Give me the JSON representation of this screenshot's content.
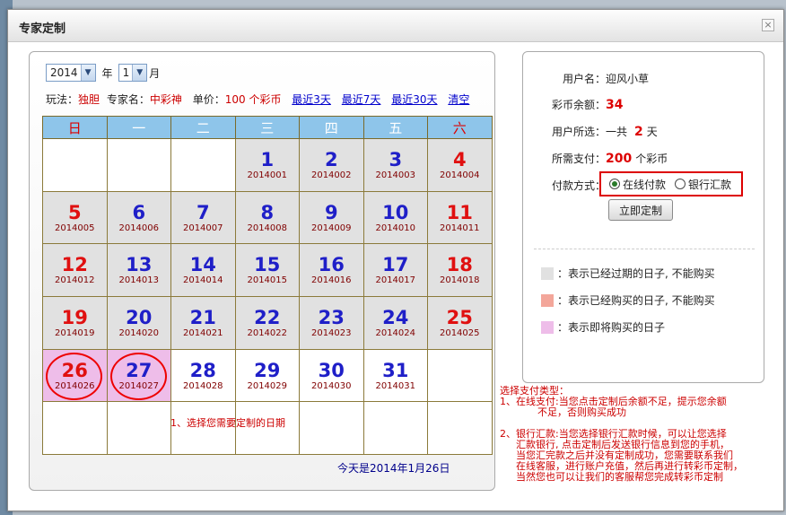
{
  "dialog": {
    "title": "专家定制",
    "close": "×"
  },
  "selectors": {
    "year": "2014",
    "year_label": "年",
    "month": "1",
    "month_label": "月"
  },
  "info": {
    "play_label": "玩法：",
    "play": "独胆",
    "expert_label": "专家名：",
    "expert": "中彩神",
    "price_label": "单价：",
    "price": "100 个彩币",
    "link3": "最近3天",
    "link7": "最近7天",
    "link30": "最近30天",
    "clear": "清空"
  },
  "weekdays": [
    "日",
    "一",
    "二",
    "三",
    "四",
    "五",
    "六"
  ],
  "weeks": [
    [
      null,
      null,
      null,
      {
        "d": "1",
        "c": "2014001",
        "s": "past"
      },
      {
        "d": "2",
        "c": "2014002",
        "s": "past"
      },
      {
        "d": "3",
        "c": "2014003",
        "s": "past"
      },
      {
        "d": "4",
        "c": "2014004",
        "s": "past"
      }
    ],
    [
      {
        "d": "5",
        "c": "2014005",
        "s": "past"
      },
      {
        "d": "6",
        "c": "2014006",
        "s": "past"
      },
      {
        "d": "7",
        "c": "2014007",
        "s": "past"
      },
      {
        "d": "8",
        "c": "2014008",
        "s": "past"
      },
      {
        "d": "9",
        "c": "2014009",
        "s": "past"
      },
      {
        "d": "10",
        "c": "2014010",
        "s": "past"
      },
      {
        "d": "11",
        "c": "2014011",
        "s": "past"
      }
    ],
    [
      {
        "d": "12",
        "c": "2014012",
        "s": "past"
      },
      {
        "d": "13",
        "c": "2014013",
        "s": "past"
      },
      {
        "d": "14",
        "c": "2014014",
        "s": "past"
      },
      {
        "d": "15",
        "c": "2014015",
        "s": "past"
      },
      {
        "d": "16",
        "c": "2014016",
        "s": "past"
      },
      {
        "d": "17",
        "c": "2014017",
        "s": "past"
      },
      {
        "d": "18",
        "c": "2014018",
        "s": "past"
      }
    ],
    [
      {
        "d": "19",
        "c": "2014019",
        "s": "past"
      },
      {
        "d": "20",
        "c": "2014020",
        "s": "past"
      },
      {
        "d": "21",
        "c": "2014021",
        "s": "past"
      },
      {
        "d": "22",
        "c": "2014022",
        "s": "past"
      },
      {
        "d": "23",
        "c": "2014023",
        "s": "past"
      },
      {
        "d": "24",
        "c": "2014024",
        "s": "past"
      },
      {
        "d": "25",
        "c": "2014025",
        "s": "past"
      }
    ],
    [
      {
        "d": "26",
        "c": "2014026",
        "s": "selected"
      },
      {
        "d": "27",
        "c": "2014027",
        "s": "selected"
      },
      {
        "d": "28",
        "c": "2014028",
        "s": "open"
      },
      {
        "d": "29",
        "c": "2014029",
        "s": "open"
      },
      {
        "d": "30",
        "c": "2014030",
        "s": "open"
      },
      {
        "d": "31",
        "c": "2014031",
        "s": "open"
      },
      null
    ],
    [
      null,
      null,
      null,
      null,
      null,
      null,
      null
    ]
  ],
  "hint_choose": "1、选择您需要定制的日期",
  "today": "今天是2014年1月26日",
  "user": {
    "name_label": "用户名：",
    "name": "迎风小草",
    "balance_label": "彩币余额：",
    "balance": "34",
    "chosen_label": "用户所选：",
    "chosen_pre": "一共",
    "chosen": "2",
    "chosen_unit": "天",
    "pay_label": "所需支付：",
    "pay": "200",
    "pay_unit": "个彩币",
    "method_label": "付款方式：",
    "method_online": "在线付款",
    "method_bank": "银行汇款",
    "submit": "立即定制"
  },
  "legend": [
    {
      "text": "：表示已经过期的日子, 不能购买",
      "color": "#e1e1e1"
    },
    {
      "text": "：表示已经购买的日子, 不能购买",
      "color": "#f3a69a"
    },
    {
      "text": "：表示即将购买的日子",
      "color": "#eebde9"
    }
  ],
  "notes": {
    "title": "选择支付类型：",
    "n1a": "1、在线支付:当您点击定制后余额不足，提示您余额",
    "n1b": "不足，否则购买成功",
    "n2a": "2、银行汇款:当您选择银行汇款时候，可以让您选择",
    "n2b": "汇款银行, 点击定制后发送银行信息到您的手机，",
    "n2c": "当您汇完款之后并没有定制成功，您需要联系我们",
    "n2d": "在线客服，进行账户充值，然后再进行转彩币定制，",
    "n2e": "当然您也可以让我们的客服帮您完成转彩币定制"
  }
}
